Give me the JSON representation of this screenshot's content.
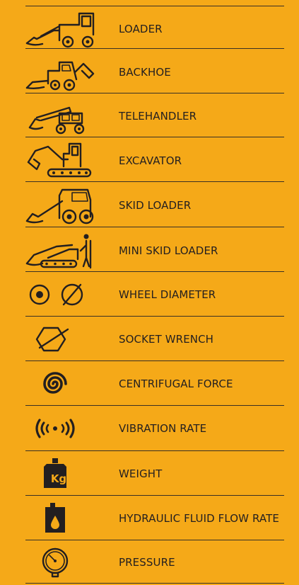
{
  "items": [
    {
      "label": "LOADER",
      "icon": "loader-icon"
    },
    {
      "label": "BACKHOE",
      "icon": "backhoe-icon"
    },
    {
      "label": "TELEHANDLER",
      "icon": "telehandler-icon"
    },
    {
      "label": "EXCAVATOR",
      "icon": "excavator-icon"
    },
    {
      "label": "SKID LOADER",
      "icon": "skid-loader-icon"
    },
    {
      "label": "MINI SKID LOADER",
      "icon": "mini-skid-loader-icon"
    },
    {
      "label": "WHEEL DIAMETER",
      "icon": "wheel-diameter-icon"
    },
    {
      "label": "SOCKET WRENCH",
      "icon": "socket-wrench-icon"
    },
    {
      "label": "CENTRIFUGAL FORCE",
      "icon": "centrifugal-force-icon"
    },
    {
      "label": "VIBRATION RATE",
      "icon": "vibration-rate-icon"
    },
    {
      "label": "WEIGHT",
      "icon": "weight-icon",
      "icon_text": "Kg"
    },
    {
      "label": "HYDRAULIC FLUID FLOW RATE",
      "icon": "hydraulic-fluid-icon"
    },
    {
      "label": "PRESSURE",
      "icon": "pressure-gauge-icon"
    }
  ],
  "colors": {
    "background": "#F5A918",
    "text": "#231f20"
  }
}
